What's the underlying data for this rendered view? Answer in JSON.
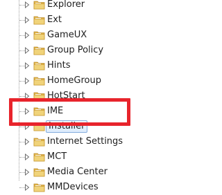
{
  "tree": {
    "items": [
      {
        "label": "Explorer",
        "selected": false
      },
      {
        "label": "Ext",
        "selected": false
      },
      {
        "label": "GameUX",
        "selected": false
      },
      {
        "label": "Group Policy",
        "selected": false
      },
      {
        "label": "Hints",
        "selected": false
      },
      {
        "label": "HomeGroup",
        "selected": false
      },
      {
        "label": "HotStart",
        "selected": false
      },
      {
        "label": "IME",
        "selected": false
      },
      {
        "label": "Installer",
        "selected": true
      },
      {
        "label": "Internet Settings",
        "selected": false
      },
      {
        "label": "MCT",
        "selected": false
      },
      {
        "label": "Media Center",
        "selected": false
      },
      {
        "label": "MMDevices",
        "selected": false
      }
    ]
  },
  "icons": {
    "expander": "collapsed-triangle-icon",
    "folder": "folder-icon"
  },
  "colors": {
    "highlight_border": "#e8242c",
    "selection_border": "#84acdd",
    "folder_body": "#f0d37a"
  }
}
